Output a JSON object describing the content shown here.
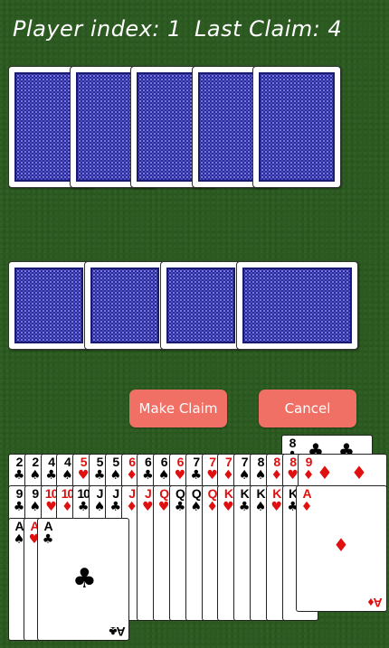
{
  "header": {
    "player_label": "Player index:",
    "player_value": "1",
    "claim_label": "Last Claim:",
    "claim_value": "4"
  },
  "buttons": {
    "make_claim": "Make Claim",
    "cancel": "Cancel"
  },
  "opponent_row1_count": 5,
  "opponent_row2_count": 4,
  "hand": {
    "row1": [
      {
        "rank": "2",
        "suit": "♣",
        "color": "black"
      },
      {
        "rank": "2",
        "suit": "♠",
        "color": "black"
      },
      {
        "rank": "4",
        "suit": "♣",
        "color": "black"
      },
      {
        "rank": "4",
        "suit": "♠",
        "color": "black"
      },
      {
        "rank": "5",
        "suit": "♥",
        "color": "red"
      },
      {
        "rank": "5",
        "suit": "♣",
        "color": "black"
      },
      {
        "rank": "5",
        "suit": "♠",
        "color": "black"
      },
      {
        "rank": "6",
        "suit": "♦",
        "color": "red"
      },
      {
        "rank": "6",
        "suit": "♣",
        "color": "black"
      },
      {
        "rank": "6",
        "suit": "♠",
        "color": "black"
      },
      {
        "rank": "6",
        "suit": "♥",
        "color": "red"
      },
      {
        "rank": "7",
        "suit": "♣",
        "color": "black"
      },
      {
        "rank": "7",
        "suit": "♥",
        "color": "red"
      },
      {
        "rank": "7",
        "suit": "♦",
        "color": "red"
      },
      {
        "rank": "7",
        "suit": "♠",
        "color": "black"
      },
      {
        "rank": "8",
        "suit": "♠",
        "color": "black"
      },
      {
        "rank": "8",
        "suit": "♦",
        "color": "red"
      },
      {
        "rank": "8",
        "suit": "♥",
        "color": "red"
      }
    ],
    "row1_top_card": {
      "rank": "8",
      "suit": "♣",
      "color": "black"
    },
    "row1_last": {
      "rank": "9",
      "suit": "♦",
      "color": "red"
    },
    "row2": [
      {
        "rank": "9",
        "suit": "♣",
        "color": "black"
      },
      {
        "rank": "9",
        "suit": "♠",
        "color": "black"
      },
      {
        "rank": "10",
        "suit": "♥",
        "color": "red"
      },
      {
        "rank": "10",
        "suit": "♦",
        "color": "red"
      },
      {
        "rank": "10",
        "suit": "♣",
        "color": "black"
      },
      {
        "rank": "J",
        "suit": "♠",
        "color": "black"
      },
      {
        "rank": "J",
        "suit": "♣",
        "color": "black"
      },
      {
        "rank": "J",
        "suit": "♦",
        "color": "red"
      },
      {
        "rank": "J",
        "suit": "♥",
        "color": "red"
      },
      {
        "rank": "Q",
        "suit": "♥",
        "color": "red"
      },
      {
        "rank": "Q",
        "suit": "♣",
        "color": "black"
      },
      {
        "rank": "Q",
        "suit": "♠",
        "color": "black"
      },
      {
        "rank": "Q",
        "suit": "♦",
        "color": "red"
      },
      {
        "rank": "K",
        "suit": "♥",
        "color": "red"
      },
      {
        "rank": "K",
        "suit": "♣",
        "color": "black"
      },
      {
        "rank": "K",
        "suit": "♠",
        "color": "black"
      },
      {
        "rank": "K",
        "suit": "♥",
        "color": "red"
      },
      {
        "rank": "K",
        "suit": "♣",
        "color": "black"
      }
    ],
    "row2_last": {
      "rank": "A",
      "suit": "♦",
      "color": "red"
    },
    "row3": [
      {
        "rank": "A",
        "suit": "♠",
        "color": "black"
      },
      {
        "rank": "A",
        "suit": "♥",
        "color": "red"
      },
      {
        "rank": "A",
        "suit": "♣",
        "color": "black"
      }
    ]
  }
}
